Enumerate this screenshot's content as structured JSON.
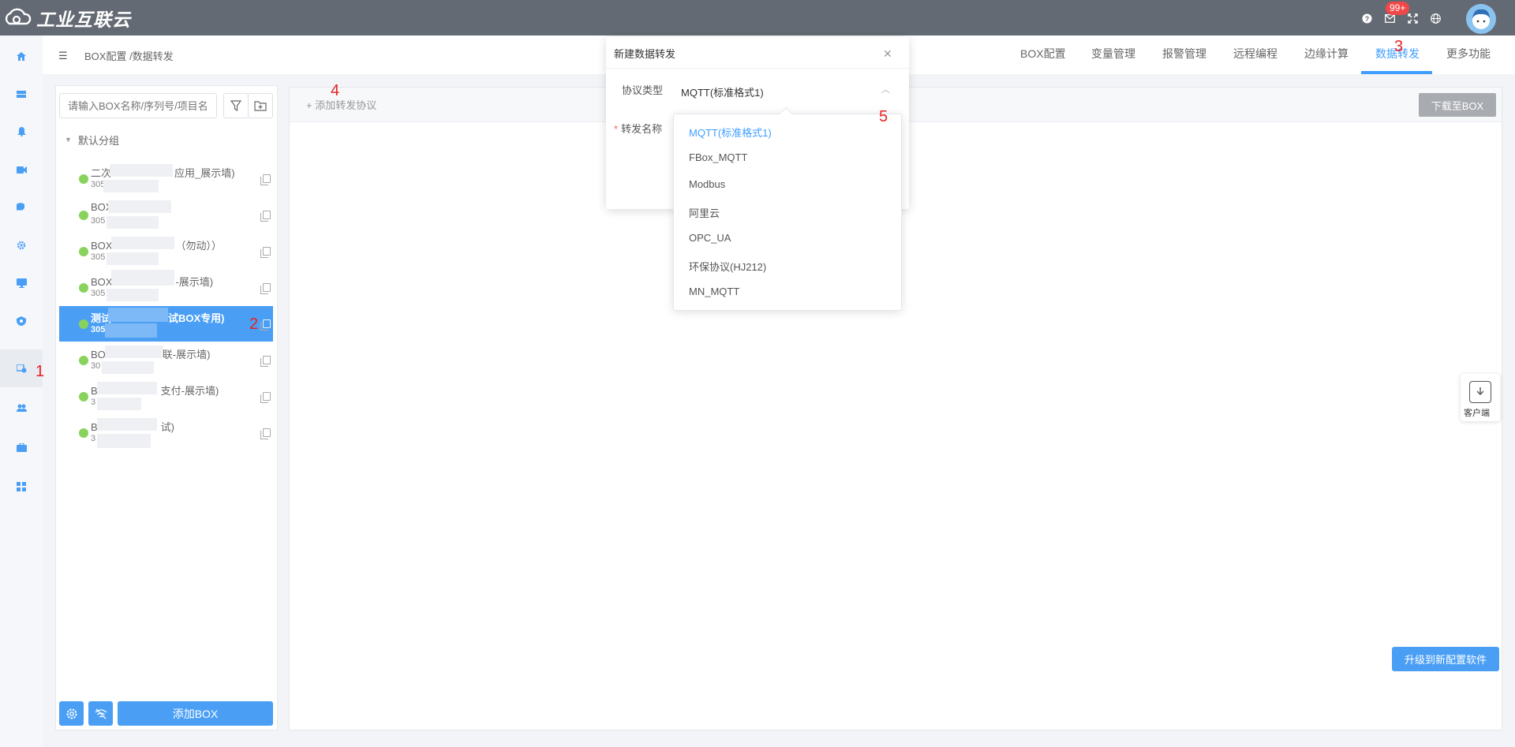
{
  "header": {
    "logo_text": "工业互联云",
    "message_badge": "99+"
  },
  "breadcrumb": "BOX配置 /数据转发",
  "tabs": [
    {
      "label": "BOX配置"
    },
    {
      "label": "变量管理"
    },
    {
      "label": "报警管理"
    },
    {
      "label": "远程编程"
    },
    {
      "label": "边缘计算"
    },
    {
      "label": "数据转发",
      "active": true
    },
    {
      "label": "更多功能"
    }
  ],
  "tree": {
    "search_placeholder": "请输入BOX名称/序列号/项目名",
    "group": "默认分组",
    "items": [
      {
        "name": "二次",
        "name_tail": "应用_展示墙)",
        "serial": "305"
      },
      {
        "name": "BOX",
        "name_tail": "",
        "serial": "305"
      },
      {
        "name": "BOX",
        "name_tail": "（勿动））",
        "serial": "305"
      },
      {
        "name": "BOX",
        "name_tail": "-展示墙)",
        "serial": "305"
      },
      {
        "name": "测试",
        "name_tail": "试BOX专用)",
        "serial": "305",
        "selected": true
      },
      {
        "name": "BO",
        "name_tail": "联-展示墙)",
        "serial": "30"
      },
      {
        "name": "B",
        "name_tail": "支付-展示墙)",
        "serial": "3"
      },
      {
        "name": "B",
        "name_tail": "试)",
        "serial": "3"
      }
    ],
    "add_box_label": "添加BOX"
  },
  "main": {
    "add_protocol_label": "+ 添加转发协议",
    "download_label": "下载至BOX",
    "upgrade_label": "升级到新配置软件",
    "client_label": "客户端"
  },
  "modal": {
    "title": "新建数据转发",
    "protocol_label": "协议类型",
    "protocol_value": "MQTT(标准格式1)",
    "name_label": "转发名称",
    "required_mark": "*"
  },
  "dropdown_options": [
    {
      "label": "MQTT(标准格式1)",
      "selected": true
    },
    {
      "label": "FBox_MQTT"
    },
    {
      "label": "Modbus"
    },
    {
      "label": "阿里云"
    },
    {
      "label": "OPC_UA"
    },
    {
      "label": "环保协议(HJ212)"
    },
    {
      "label": "MN_MQTT"
    }
  ],
  "annotations": [
    "1",
    "2",
    "3",
    "4",
    "5"
  ],
  "colors": {
    "accent": "#409eff",
    "header": "#646a73",
    "selected": "#4a9ff5",
    "online": "#88d35d",
    "marker": "#e82020"
  }
}
